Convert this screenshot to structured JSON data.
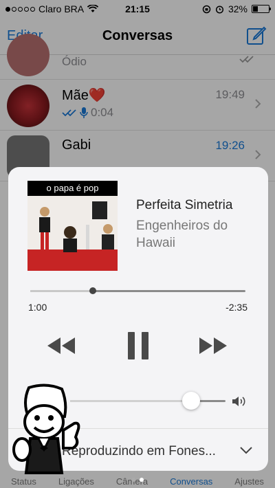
{
  "status_bar": {
    "carrier": "Claro BRA",
    "time": "21:15",
    "battery": "32%",
    "battery_level": 0.32
  },
  "nav": {
    "edit": "Editar",
    "title": "Conversas"
  },
  "chats": [
    {
      "preview": "Ódio"
    },
    {
      "name": "Mãe",
      "emoji": "❤️",
      "time": "19:49",
      "duration": "0:04"
    },
    {
      "name": "Gabi",
      "time": "19:26"
    }
  ],
  "tabs": [
    "Status",
    "Ligações",
    "Câmera",
    "Conversas",
    "Ajustes"
  ],
  "now_playing": {
    "album_text": "o papa é pop",
    "title": "Perfeita Simetria",
    "artist": "Engenheiros do Hawaii",
    "elapsed": "1:00",
    "remaining": "-2:35",
    "progress_fraction": 0.29,
    "volume_fraction": 0.78,
    "route": "Reproduzindo em Fones..."
  },
  "icons": {
    "compose": "compose-icon",
    "rewind": "rewind-icon",
    "pause": "pause-icon",
    "forward": "fast-forward-icon",
    "volume": "speaker-icon",
    "route_chevron": "chevron-down-icon"
  },
  "colors": {
    "accent": "#1a7ad9",
    "badge": "#1a7ad9"
  }
}
